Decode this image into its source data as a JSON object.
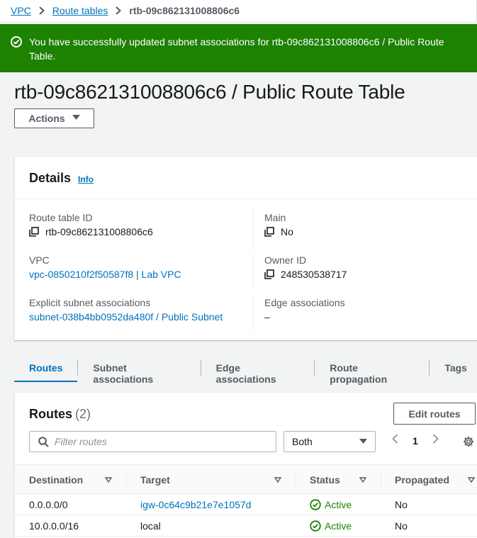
{
  "breadcrumb": {
    "items": [
      "VPC",
      "Route tables"
    ],
    "current": "rtb-09c862131008806c6"
  },
  "flash": {
    "message": "You have successfully updated subnet associations for rtb-09c862131008806c6 / Public Route Table.",
    "icon": "check-circle-icon",
    "color": "#1d8102"
  },
  "page": {
    "title": "rtb-09c862131008806c6 / Public Route Table",
    "actions_label": "Actions"
  },
  "details": {
    "title": "Details",
    "info_link": "Info",
    "route_table_id_label": "Route table ID",
    "route_table_id": "rtb-09c862131008806c6",
    "main_label": "Main",
    "main": "No",
    "vpc_label": "VPC",
    "vpc": "vpc-0850210f2f50587f8 | Lab VPC",
    "owner_label": "Owner ID",
    "owner": "248530538717",
    "subnet_assoc_label": "Explicit subnet associations",
    "subnet_assoc": "subnet-038b4bb0952da480f / Public Subnet",
    "edge_assoc_label": "Edge associations",
    "edge_assoc": "–"
  },
  "tabs": [
    {
      "label": "Routes",
      "active": true
    },
    {
      "label": "Subnet associations"
    },
    {
      "label": "Edge associations"
    },
    {
      "label": "Route propagation"
    },
    {
      "label": "Tags"
    }
  ],
  "routes": {
    "title": "Routes",
    "count": "(2)",
    "edit_label": "Edit routes",
    "search_placeholder": "Filter routes",
    "filter_value": "Both",
    "page": "1",
    "columns": [
      "Destination",
      "Target",
      "Status",
      "Propagated"
    ],
    "rows": [
      {
        "destination": "0.0.0.0/0",
        "target": "igw-0c64c9b21e7e1057d",
        "target_link": true,
        "status": "Active",
        "propagated": "No"
      },
      {
        "destination": "10.0.0.0/16",
        "target": "local",
        "target_link": false,
        "status": "Active",
        "propagated": "No"
      }
    ]
  },
  "colors": {
    "link": "#0073bb",
    "success": "#1d8102"
  }
}
